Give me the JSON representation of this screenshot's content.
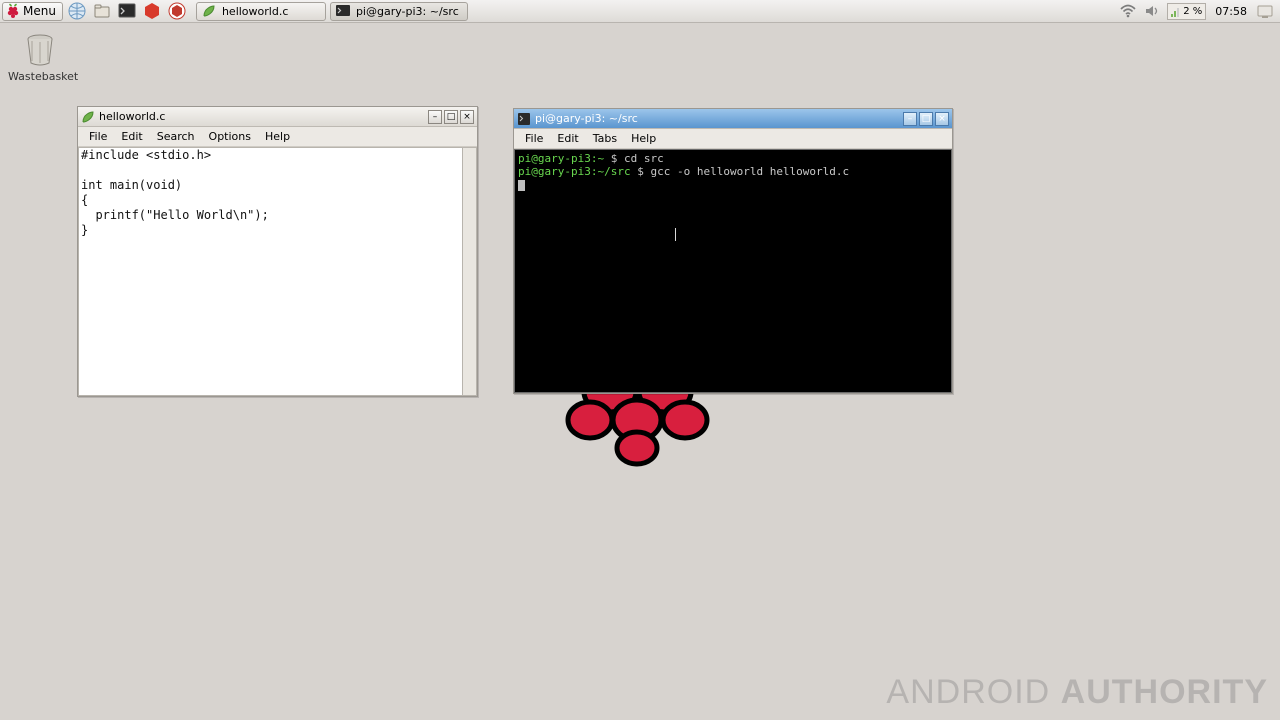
{
  "taskbar": {
    "menu_label": "Menu",
    "tasks": [
      {
        "label": "helloworld.c",
        "icon": "leaf"
      },
      {
        "label": "pi@gary-pi3: ~/src",
        "icon": "terminal"
      }
    ],
    "cpu": "2 %",
    "clock": "07:58"
  },
  "desktop": {
    "wastebasket": "Wastebasket"
  },
  "editor": {
    "title": "helloworld.c",
    "menus": [
      "File",
      "Edit",
      "Search",
      "Options",
      "Help"
    ],
    "content": "#include <stdio.h>\n\nint main(void)\n{\n  printf(\"Hello World\\n\");\n}"
  },
  "terminal": {
    "title": "pi@gary-pi3: ~/src",
    "menus": [
      "File",
      "Edit",
      "Tabs",
      "Help"
    ],
    "lines": [
      {
        "user": "pi@gary-pi3",
        "path": "~",
        "cmd": "cd src"
      },
      {
        "user": "pi@gary-pi3",
        "path": "~/src",
        "cmd": "gcc -o helloworld helloworld.c"
      }
    ]
  },
  "watermark": {
    "a": "ANDROID",
    "b": "AUTHORITY"
  }
}
